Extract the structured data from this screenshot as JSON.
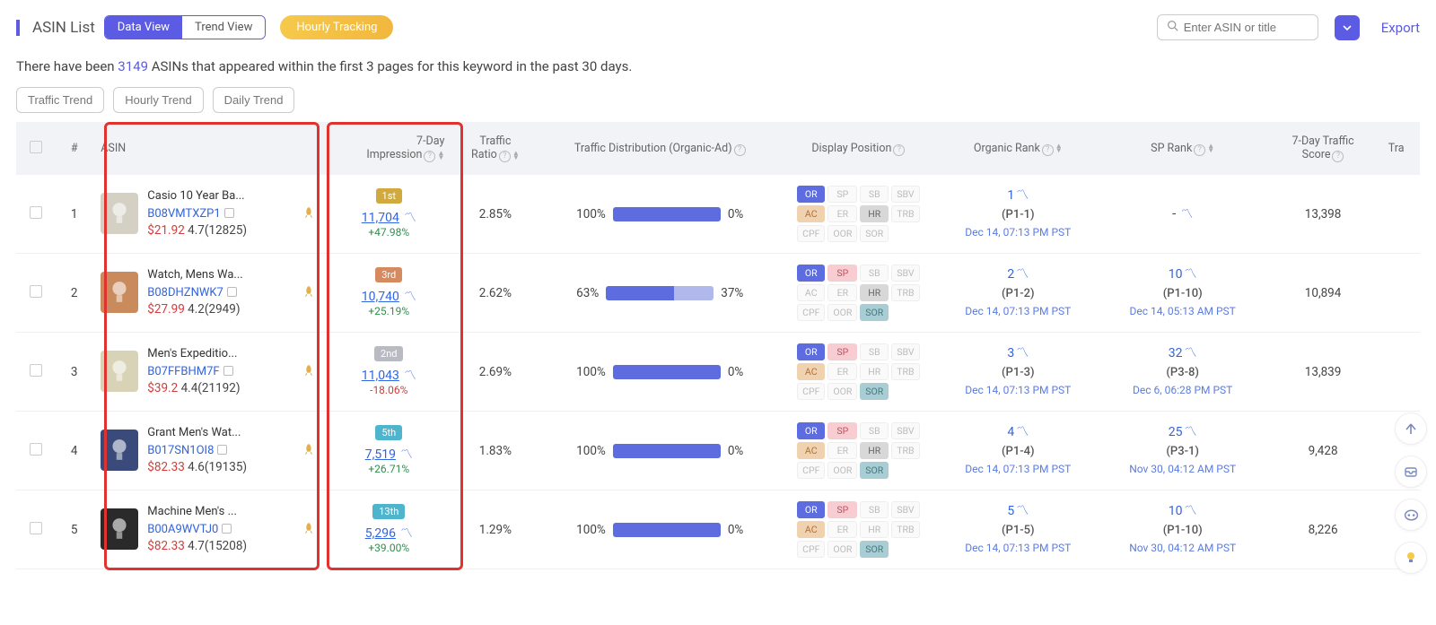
{
  "header": {
    "title": "ASIN List",
    "tabs": [
      "Data View",
      "Trend View"
    ],
    "active_tab": 0,
    "pill": "Hourly Tracking",
    "search_placeholder": "Enter ASIN or title",
    "export": "Export"
  },
  "intro": {
    "pre": "There have been ",
    "count": "3149",
    "post": " ASINs that appeared within the first 3 pages for this keyword in the past 30 days."
  },
  "trend_buttons": [
    "Traffic Trend",
    "Hourly Trend",
    "Daily Trend"
  ],
  "columns": {
    "idx": "#",
    "asin": "ASIN",
    "imp": "7-Day\nImpression",
    "ratio": "Traffic\nRatio",
    "dist": "Traffic Distribution (Organic-Ad)",
    "dpos": "Display Position",
    "orank": "Organic Rank",
    "sprank": "SP Rank",
    "score": "7-Day Traffic\nScore",
    "trail": "Tra"
  },
  "rows": [
    {
      "n": 1,
      "name": "Casio 10 Year Ba...",
      "asin": "B08VMTXZP1",
      "price": "$21.92",
      "rating": "4.7(12825)",
      "rank_label": "1st",
      "rank_color": "#d0a93f",
      "imp": "11,704",
      "pct": "+47.98%",
      "pct_dir": "pos",
      "ratio": "2.85%",
      "org": 100,
      "ad": 0,
      "orgtxt": "100%",
      "adtxt": "0%",
      "pos": {
        "OR": true,
        "SP": false,
        "SB": false,
        "SBV": false,
        "AC": true,
        "ER": false,
        "HR": true,
        "TRB": false,
        "CPF": false,
        "OOR": false,
        "SOR": false
      },
      "or_n": "1",
      "or_p": "(P1-1)",
      "or_t": "Dec 14, 07:13 PM PST",
      "sp_n": "-",
      "sp_p": "",
      "sp_t": "",
      "score": "13,398",
      "thumb": "#d5d0c4"
    },
    {
      "n": 2,
      "name": "Watch, Mens Wa...",
      "asin": "B08DHZNWK7",
      "price": "$27.99",
      "rating": "4.2(2949)",
      "rank_label": "3rd",
      "rank_color": "#d68a5f",
      "imp": "10,740",
      "pct": "+25.19%",
      "pct_dir": "pos",
      "ratio": "2.62%",
      "org": 63,
      "ad": 37,
      "orgtxt": "63%",
      "adtxt": "37%",
      "pos": {
        "OR": true,
        "SP": true,
        "SB": false,
        "SBV": false,
        "AC": false,
        "ER": false,
        "HR": true,
        "TRB": false,
        "CPF": false,
        "OOR": false,
        "SOR": true
      },
      "or_n": "2",
      "or_p": "(P1-2)",
      "or_t": "Dec 14, 07:13 PM PST",
      "sp_n": "10",
      "sp_p": "(P1-10)",
      "sp_t": "Dec 14, 05:13 AM PST",
      "score": "10,894",
      "thumb": "#c98a5c"
    },
    {
      "n": 3,
      "name": "Men's Expeditio...",
      "asin": "B07FFBHM7F",
      "price": "$39.2",
      "rating": "4.4(21192)",
      "rank_label": "2nd",
      "rank_color": "#b8bbc2",
      "imp": "11,043",
      "pct": "-18.06%",
      "pct_dir": "neg",
      "ratio": "2.69%",
      "org": 100,
      "ad": 0,
      "orgtxt": "100%",
      "adtxt": "0%",
      "pos": {
        "OR": true,
        "SP": true,
        "SB": false,
        "SBV": false,
        "AC": true,
        "ER": false,
        "HR": false,
        "TRB": false,
        "CPF": false,
        "OOR": false,
        "SOR": true
      },
      "or_n": "3",
      "or_p": "(P1-3)",
      "or_t": "Dec 14, 07:13 PM PST",
      "sp_n": "32",
      "sp_p": "(P3-8)",
      "sp_t": "Dec 6, 06:28 PM PST",
      "score": "13,839",
      "thumb": "#d8d2b6"
    },
    {
      "n": 4,
      "name": "Grant Men's Wat...",
      "asin": "B017SN1OI8",
      "price": "$82.33",
      "rating": "4.6(19135)",
      "rank_label": "5th",
      "rank_color": "#4fb5cc",
      "imp": "7,519",
      "pct": "+26.71%",
      "pct_dir": "pos",
      "ratio": "1.83%",
      "org": 100,
      "ad": 0,
      "orgtxt": "100%",
      "adtxt": "0%",
      "pos": {
        "OR": true,
        "SP": true,
        "SB": false,
        "SBV": false,
        "AC": true,
        "ER": false,
        "HR": true,
        "TRB": false,
        "CPF": false,
        "OOR": false,
        "SOR": true
      },
      "or_n": "4",
      "or_p": "(P1-4)",
      "or_t": "Dec 14, 07:13 PM PST",
      "sp_n": "25",
      "sp_p": "(P3-1)",
      "sp_t": "Nov 30, 04:12 AM PST",
      "score": "9,428",
      "thumb": "#3a4a7a"
    },
    {
      "n": 5,
      "name": "Machine Men's ...",
      "asin": "B00A9WVTJ0",
      "price": "$82.33",
      "rating": "4.7(15208)",
      "rank_label": "13th",
      "rank_color": "#4fb5cc",
      "imp": "5,296",
      "pct": "+39.00%",
      "pct_dir": "pos",
      "ratio": "1.29%",
      "org": 100,
      "ad": 0,
      "orgtxt": "100%",
      "adtxt": "0%",
      "pos": {
        "OR": true,
        "SP": true,
        "SB": false,
        "SBV": false,
        "AC": true,
        "ER": false,
        "HR": false,
        "TRB": false,
        "CPF": false,
        "OOR": false,
        "SOR": true
      },
      "or_n": "5",
      "or_p": "(P1-5)",
      "or_t": "Dec 14, 07:13 PM PST",
      "sp_n": "10",
      "sp_p": "(P1-10)",
      "sp_t": "Nov 30, 04:12 AM PST",
      "score": "8,226",
      "thumb": "#2a2a2a"
    }
  ],
  "pos_labels": [
    "OR",
    "SP",
    "SB",
    "SBV",
    "AC",
    "ER",
    "HR",
    "TRB",
    "CPF",
    "OOR",
    "SOR"
  ]
}
